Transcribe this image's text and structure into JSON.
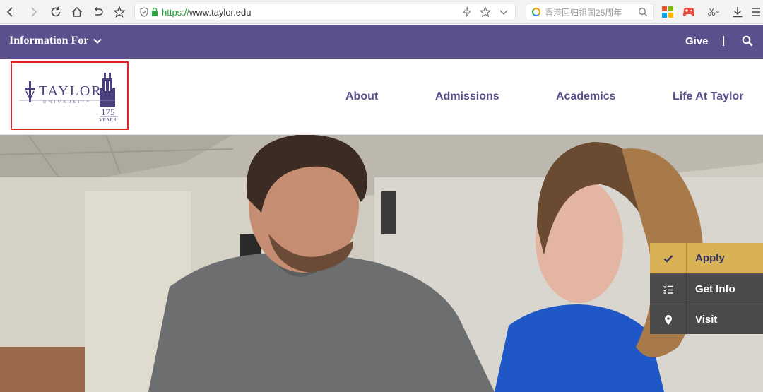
{
  "browser": {
    "url_protocol": "https://",
    "url_rest": "www.taylor.edu",
    "search_hint": "香港回归祖国25周年",
    "icons": [
      "back-icon",
      "forward-icon",
      "reload-icon",
      "home-icon",
      "undo-icon",
      "bookmark-star-icon",
      "shield-icon",
      "lock-icon",
      "lightning-icon",
      "favorite-icon",
      "dropdown-icon",
      "search-icon",
      "apps-icon",
      "game-icon",
      "scissors-icon",
      "download-icon",
      "menu-icon"
    ]
  },
  "topbar": {
    "info_label": "Information For",
    "give_label": "Give",
    "separator": "|",
    "bg_color": "#5b4f8c"
  },
  "logo": {
    "name": "TAYLOR",
    "sub": "UNIVERSITY",
    "years_num": "175",
    "years_word": "YEARS"
  },
  "nav": {
    "items": [
      "About",
      "Admissions",
      "Academics",
      "Life At Taylor"
    ],
    "color": "#5b4f8c"
  },
  "cta": {
    "apply_label": "Apply",
    "info_label": "Get Info",
    "visit_label": "Visit",
    "apply_color": "#d8b154",
    "dark_color": "#4a4a4a"
  }
}
